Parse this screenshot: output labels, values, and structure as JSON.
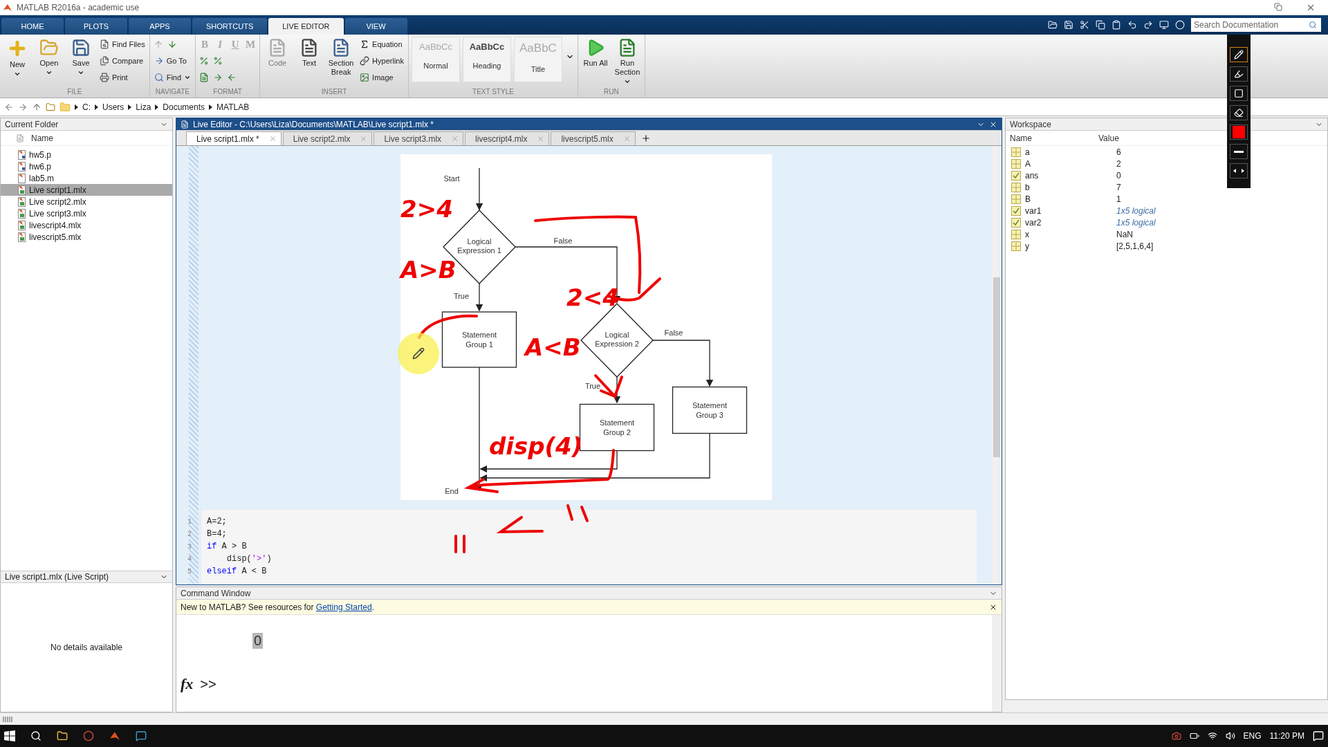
{
  "window": {
    "title": "MATLAB R2016a - academic use"
  },
  "ribbon_tabs": [
    {
      "label": "HOME",
      "selected": false
    },
    {
      "label": "PLOTS",
      "selected": false
    },
    {
      "label": "APPS",
      "selected": false
    },
    {
      "label": "SHORTCUTS",
      "selected": false
    },
    {
      "label": "LIVE EDITOR",
      "selected": true
    },
    {
      "label": "VIEW",
      "selected": false
    }
  ],
  "search": {
    "placeholder": "Search Documentation"
  },
  "ribbon_groups": [
    {
      "title": "FILE",
      "columns": [
        [
          {
            "kind": "large",
            "label": "New",
            "dropdown": true,
            "disabled": false
          }
        ],
        [
          {
            "kind": "large",
            "label": "Open",
            "dropdown": true,
            "disabled": false
          }
        ],
        [
          {
            "kind": "large",
            "label": "Save",
            "dropdown": true,
            "disabled": false
          }
        ],
        [
          {
            "kind": "small",
            "label": "Find Files",
            "dropdown": false
          },
          {
            "kind": "small",
            "label": "Compare",
            "dropdown": false
          },
          {
            "kind": "small",
            "label": "Print",
            "dropdown": false
          }
        ]
      ]
    },
    {
      "title": "NAVIGATE",
      "columns": [
        [
          {
            "kind": "row",
            "items": [
              {
                "kind": "icon",
                "disabled": true
              },
              {
                "kind": "icon",
                "disabled": false
              }
            ]
          },
          {
            "kind": "small",
            "label": "Go To",
            "dropdown": false
          },
          {
            "kind": "small",
            "label": "Find",
            "dropdown": true
          }
        ]
      ]
    },
    {
      "title": "FORMAT",
      "columns": [
        [
          {
            "kind": "row",
            "items": [
              {
                "kind": "letter",
                "label": "B",
                "disabled": true
              },
              {
                "kind": "letter",
                "label": "I",
                "disabled": true
              },
              {
                "kind": "letter",
                "label": "U",
                "disabled": true
              },
              {
                "kind": "letter",
                "label": "M",
                "disabled": true
              }
            ]
          },
          {
            "kind": "row",
            "items": [
              {
                "kind": "icon",
                "disabled": false
              },
              {
                "kind": "icon",
                "disabled": false
              }
            ]
          },
          {
            "kind": "row",
            "items": [
              {
                "kind": "icon",
                "disabled": false
              },
              {
                "kind": "icon",
                "disabled": false
              },
              {
                "kind": "icon",
                "disabled": false
              }
            ]
          }
        ]
      ]
    },
    {
      "title": "INSERT",
      "columns": [
        [
          {
            "kind": "large",
            "label": "Code",
            "dropdown": false,
            "disabled": true
          }
        ],
        [
          {
            "kind": "large",
            "label": "Text",
            "dropdown": false,
            "disabled": false
          }
        ],
        [
          {
            "kind": "large",
            "label": "Section Break",
            "dropdown": false,
            "disabled": false
          }
        ],
        [
          {
            "kind": "small",
            "label": "Equation",
            "dropdown": false
          },
          {
            "kind": "small",
            "label": "Hyperlink",
            "dropdown": false
          },
          {
            "kind": "small",
            "label": "Image",
            "dropdown": false
          }
        ]
      ]
    },
    {
      "title": "TEXT STYLE",
      "columns": [
        [
          {
            "kind": "style",
            "sample": "AaBbCc",
            "label": "Normal"
          }
        ],
        [
          {
            "kind": "style",
            "sample": "AaBbCc",
            "label": "Heading"
          }
        ],
        [
          {
            "kind": "style",
            "sample": "AaBbC",
            "label": "Title"
          }
        ],
        [
          {
            "kind": "more"
          }
        ]
      ]
    },
    {
      "title": "RUN",
      "columns": [
        [
          {
            "kind": "large",
            "label": "Run All",
            "dropdown": false,
            "disabled": false
          }
        ],
        [
          {
            "kind": "large",
            "label": "Run Section",
            "dropdown": true,
            "disabled": false
          }
        ]
      ]
    }
  ],
  "address": [
    "C:",
    "Users",
    "Liza",
    "Documents",
    "MATLAB"
  ],
  "current_folder": {
    "title": "Current Folder",
    "column": "Name",
    "files": [
      {
        "name": "hw5.p",
        "kind": "p",
        "selected": false
      },
      {
        "name": "hw6.p",
        "kind": "p",
        "selected": false
      },
      {
        "name": "lab5.m",
        "kind": "m",
        "selected": false
      },
      {
        "name": "Live script1.mlx",
        "kind": "mlx",
        "selected": true
      },
      {
        "name": "Live script2.mlx",
        "kind": "mlx",
        "selected": false
      },
      {
        "name": "Live script3.mlx",
        "kind": "mlx",
        "selected": false
      },
      {
        "name": "livescript4.mlx",
        "kind": "mlx",
        "selected": false
      },
      {
        "name": "livescript5.mlx",
        "kind": "mlx",
        "selected": false
      }
    ],
    "details_title": "Live script1.mlx  (Live Script)",
    "details_text": "No details available"
  },
  "editor": {
    "title": "Live Editor - C:\\Users\\Liza\\Documents\\MATLAB\\Live script1.mlx *",
    "tabs": [
      {
        "label": "Live script1.mlx *",
        "selected": true
      },
      {
        "label": "Live script2.mlx",
        "selected": false
      },
      {
        "label": "Live script3.mlx",
        "selected": false
      },
      {
        "label": "livescript4.mlx",
        "selected": false
      },
      {
        "label": "livescript5.mlx",
        "selected": false
      }
    ],
    "flowchart": {
      "nodes": [
        {
          "kind": "terminal",
          "label": "Start"
        },
        {
          "kind": "decision",
          "label": "Logical Expression 1"
        },
        {
          "kind": "edge",
          "label": "False"
        },
        {
          "kind": "edge",
          "label": "True"
        },
        {
          "kind": "process",
          "label": "Statement Group 1"
        },
        {
          "kind": "decision",
          "label": "Logical Expression 2"
        },
        {
          "kind": "edge",
          "label": "False"
        },
        {
          "kind": "edge",
          "label": "True"
        },
        {
          "kind": "process",
          "label": "Statement Group 2"
        },
        {
          "kind": "process",
          "label": "Statement Group 3"
        },
        {
          "kind": "terminal",
          "label": "End"
        }
      ],
      "handwriting": [
        "2>4",
        "A>B",
        "2<4",
        "A<B",
        "disp(4)"
      ]
    },
    "code": [
      {
        "number": "1",
        "tokens": [
          {
            "kind": "plain",
            "text": "A=2;"
          }
        ]
      },
      {
        "number": "2",
        "tokens": [
          {
            "kind": "plain",
            "text": "B=4;"
          }
        ]
      },
      {
        "number": "3",
        "tokens": [
          {
            "kind": "keyword",
            "text": "if"
          },
          {
            "kind": "plain",
            "text": " A > B"
          }
        ]
      },
      {
        "number": "4",
        "tokens": [
          {
            "kind": "plain",
            "text": "    disp("
          },
          {
            "kind": "string",
            "text": "'>'"
          },
          {
            "kind": "plain",
            "text": ")"
          }
        ]
      },
      {
        "number": "5",
        "tokens": [
          {
            "kind": "keyword",
            "text": "elseif"
          },
          {
            "kind": "plain",
            "text": " A < B"
          }
        ]
      }
    ]
  },
  "command_window": {
    "title": "Command Window",
    "notice": "New to MATLAB? See resources for ",
    "notice_link": "Getting Started",
    "notice_end": ".",
    "output": "0",
    "prompt_icon": "fx",
    "prompt": ">>"
  },
  "workspace": {
    "title": "Workspace",
    "columns": [
      "Name",
      "Value"
    ],
    "rows": [
      {
        "name": "a",
        "value": "6",
        "kind": "numeric",
        "summary": false
      },
      {
        "name": "A",
        "value": "2",
        "kind": "numeric",
        "summary": false
      },
      {
        "name": "ans",
        "value": "0",
        "kind": "logical",
        "summary": false
      },
      {
        "name": "b",
        "value": "7",
        "kind": "numeric",
        "summary": false
      },
      {
        "name": "B",
        "value": "1",
        "kind": "numeric",
        "summary": false
      },
      {
        "name": "var1",
        "value": "1x5 logical",
        "kind": "logical",
        "summary": true
      },
      {
        "name": "var2",
        "value": "1x5 logical",
        "kind": "logical",
        "summary": true
      },
      {
        "name": "x",
        "value": "NaN",
        "kind": "numeric",
        "summary": false
      },
      {
        "name": "y",
        "value": "[2,5,1,6,4]",
        "kind": "numeric",
        "summary": false
      }
    ]
  },
  "pen_toolbar": {
    "tools": [
      {
        "selected": true
      },
      {
        "selected": false
      },
      {
        "selected": false
      },
      {
        "selected": false
      }
    ],
    "color": "#ff0000"
  },
  "taskbar": {
    "language": "ENG",
    "time": "11:20 PM"
  }
}
